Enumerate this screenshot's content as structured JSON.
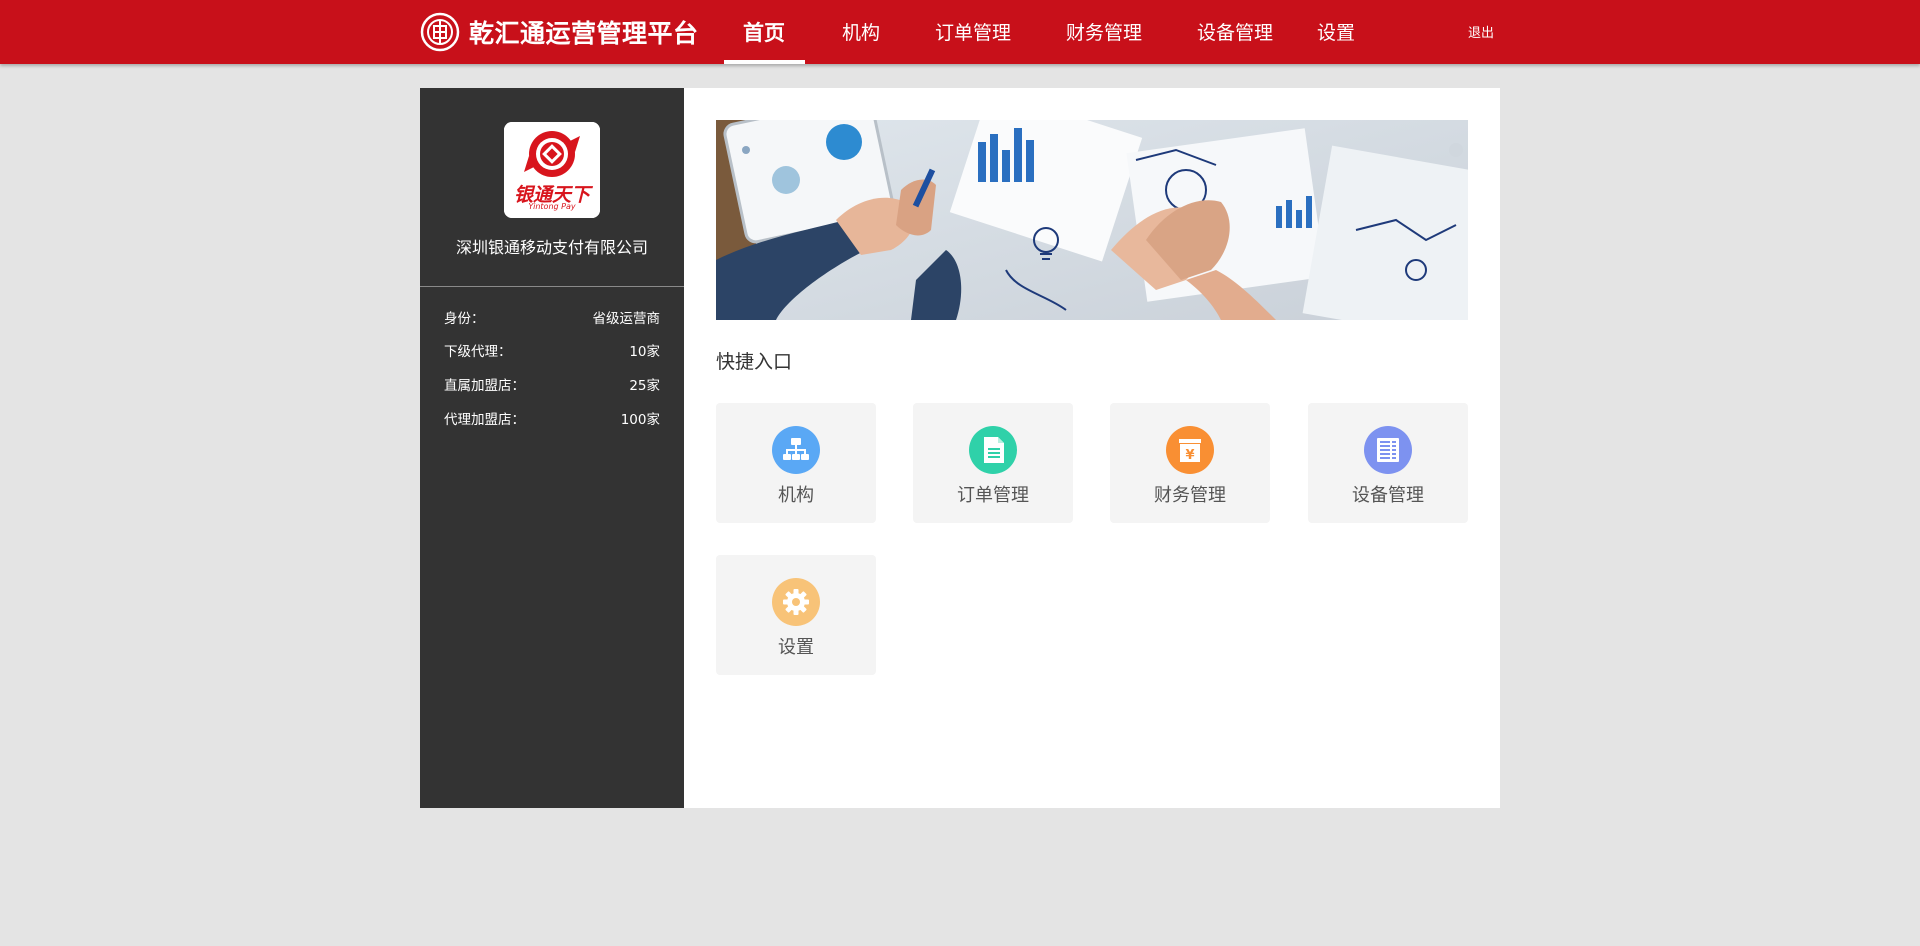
{
  "header": {
    "title": "乾汇通运营管理平台",
    "logo_icon": "qianhuitong-logo",
    "nav": [
      {
        "label": "首页",
        "active": true
      },
      {
        "label": "机构",
        "active": false
      },
      {
        "label": "订单管理",
        "active": false
      },
      {
        "label": "财务管理",
        "active": false
      },
      {
        "label": "设备管理",
        "active": false
      },
      {
        "label": "设置",
        "active": false
      }
    ],
    "logout_label": "退出",
    "bar_color": "#c8101a"
  },
  "sidebar": {
    "org_logo": {
      "brand_text": "银通天下",
      "brand_subtext": "Yintong Pay"
    },
    "org_name": "深圳银通移动支付有限公司",
    "info": [
      {
        "label": "身份：",
        "value": "省级运营商"
      },
      {
        "label": "下级代理：",
        "value": "10家"
      },
      {
        "label": "直属加盟店：",
        "value": "25家"
      },
      {
        "label": "代理加盟店：",
        "value": "100家"
      }
    ],
    "background": "#333333"
  },
  "main": {
    "banner_image": "business-teamwork-photo",
    "quick_title": "快捷入口",
    "shortcuts": [
      {
        "label": "机构",
        "icon": "org-chart-icon",
        "color": "#5aa8f5"
      },
      {
        "label": "订单管理",
        "icon": "document-icon",
        "color": "#2fd1a9"
      },
      {
        "label": "财务管理",
        "icon": "yuan-icon",
        "color": "#f98f33"
      },
      {
        "label": "设备管理",
        "icon": "device-icon",
        "color": "#7d92f0"
      },
      {
        "label": "设置",
        "icon": "gear-icon",
        "color": "#f8c378"
      }
    ]
  }
}
